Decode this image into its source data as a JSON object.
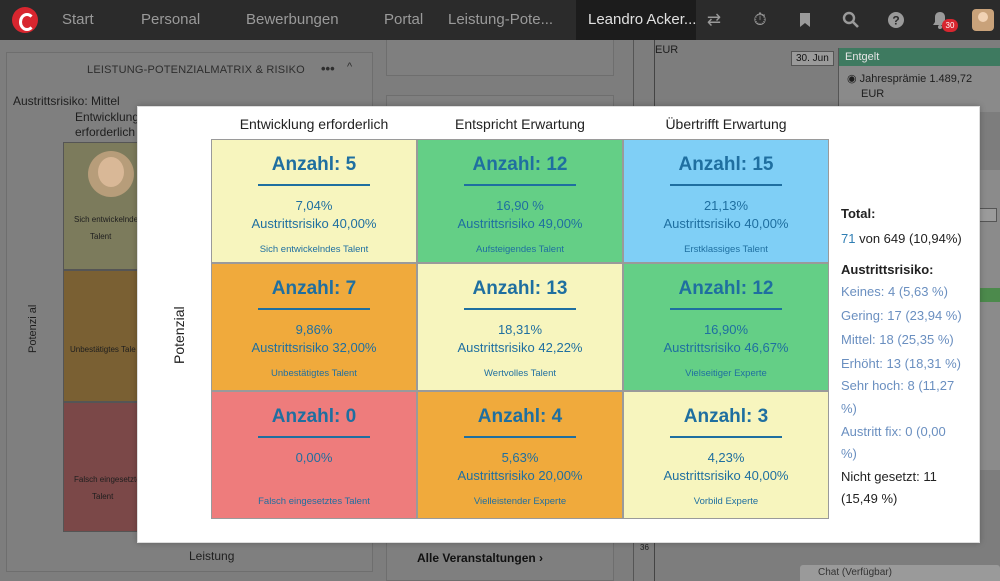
{
  "topnav": {
    "items": [
      "Start",
      "Personal",
      "Bewerbungen",
      "Portal",
      "Leistung-Pote..."
    ],
    "active_user": "Leandro Acker...",
    "notification_count": "30"
  },
  "left_widget": {
    "title": "LEISTUNG-POTENZIALMATRIX & RISIKO",
    "more": "•••",
    "caret": "^",
    "risk_label": "Austrittsrisiko: Mittel",
    "col_line1": "Entwicklung",
    "col_line2": "erforderlich",
    "cell1": "Sich entwickelnde",
    "cell1b": "Talent",
    "cell2": "Unbestätigtes Tale",
    "cell3": "Falsch eingesetztes",
    "cell3b": "Talent",
    "axis": "Potenzi al",
    "footer": "Leistung"
  },
  "mid_widget": {
    "footer_link": "Alle Veranstaltungen ›"
  },
  "right_bg": {
    "eur_top": "EUR",
    "date_tag": "30. Jun",
    "entgelt_title": "Entgelt",
    "entgelt_item": "Jahresprämie 1.489,72",
    "entgelt_currency": "EUR",
    "tick": "36",
    "chat": "Chat (Verfügbar)"
  },
  "matrix": {
    "columns": [
      "Entwicklung erforderlich",
      "Entspricht Erwartung",
      "Übertrifft Erwartung"
    ],
    "y_label": "Potenzial",
    "cells": [
      {
        "count": "Anzahl: 5",
        "pct": "7,04%",
        "risk": "Austrittsrisiko 40,00%",
        "name": "Sich entwickelndes Talent",
        "color": "#f7f5be"
      },
      {
        "count": "Anzahl: 12",
        "pct": "16,90 %",
        "risk": "Austrittsrisiko 49,00%",
        "name": "Aufsteigendes Talent",
        "color": "#64cf86"
      },
      {
        "count": "Anzahl: 15",
        "pct": "21,13%",
        "risk": "Austrittsrisiko 40,00%",
        "name": "Erstklassiges Talent",
        "color": "#7fcff6"
      },
      {
        "count": "Anzahl: 7",
        "pct": "9,86%",
        "risk": "Austrittsrisiko 32,00%",
        "name": "Unbestätigtes Talent",
        "color": "#f0aa3c"
      },
      {
        "count": "Anzahl: 13",
        "pct": "18,31%",
        "risk": "Austrittsrisiko 42,22%",
        "name": "Wertvolles Talent",
        "color": "#f7f5be"
      },
      {
        "count": "Anzahl: 12",
        "pct": "16,90%",
        "risk": "Austrittsrisiko 46,67%",
        "name": "Vielseitiger Experte",
        "color": "#64cf86"
      },
      {
        "count": "Anzahl: 0",
        "pct": "0,00%",
        "risk": "",
        "name": "Falsch eingesetztes Talent",
        "color": "#ee7c7c"
      },
      {
        "count": "Anzahl: 4",
        "pct": "5,63%",
        "risk": "Austrittsrisiko 20,00%",
        "name": "Vielleistender Experte",
        "color": "#f0aa3c"
      },
      {
        "count": "Anzahl: 3",
        "pct": "4,23%",
        "risk": "Austrittsrisiko 40,00%",
        "name": "Vorbild Experte",
        "color": "#f7f5be"
      }
    ]
  },
  "summary": {
    "total_label": "Total:",
    "total_count": "71",
    "total_rest": "von 649 (10,94%)",
    "risk_title": "Austrittsrisiko:",
    "keines": "Keines: 4 (5,63 %)",
    "gering": "Gering: 17 (23,94 %)",
    "mittel": "Mittel: 18 (25,35 %)",
    "erhoeht": "Erhöht: 13 (18,31 %)",
    "sehr_hoch_1": "Sehr hoch: 8 (11,27",
    "sehr_hoch_2": "%)",
    "fix_1": "Austritt fix: 0 (0,00",
    "fix_2": "%)",
    "nicht_1": "Nicht gesetzt: 11",
    "nicht_2": "(15,49 %)"
  }
}
